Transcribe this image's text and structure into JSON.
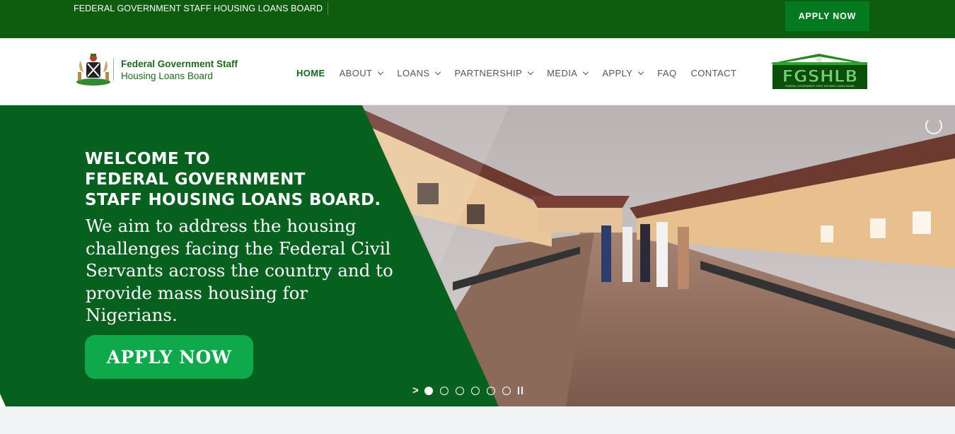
{
  "topbar": {
    "board_name": "FEDERAL GOVERNMENT STAFF HOUSING LOANS BOARD",
    "apply_label": "APPLY NOW"
  },
  "logo": {
    "line1": "Federal Government Staff",
    "line2": "Housing Loans Board"
  },
  "nav": {
    "items": [
      {
        "label": "HOME",
        "active": true,
        "dropdown": false
      },
      {
        "label": "ABOUT",
        "dropdown": true
      },
      {
        "label": "LOANS",
        "dropdown": true
      },
      {
        "label": "PARTNERSHIP",
        "dropdown": true
      },
      {
        "label": "MEDIA",
        "dropdown": true
      },
      {
        "label": "APPLY",
        "dropdown": true
      },
      {
        "label": "FAQ",
        "dropdown": false
      },
      {
        "label": "CONTACT",
        "dropdown": false
      }
    ]
  },
  "right_logo": {
    "text": "FGSHLB",
    "tagline": "FEDERAL GOVERNMENT STAFF HOUSING LOANS BOARD"
  },
  "hero": {
    "headline": [
      "WELCOME TO",
      "FEDERAL GOVERNMENT",
      "STAFF HOUSING LOANS BOARD."
    ],
    "subtext": "We aim to address the housing challenges facing the Federal Civil Servants across the country and to provide mass housing for Nigerians.",
    "apply_label": "APPLY NOW",
    "slides_total": 6,
    "slide_active": 1
  },
  "colors": {
    "dark_green": "#0e5c0e",
    "panel_green": "#06611f",
    "button_green": "#0ea94a",
    "nav_active": "#0e6a1a"
  }
}
